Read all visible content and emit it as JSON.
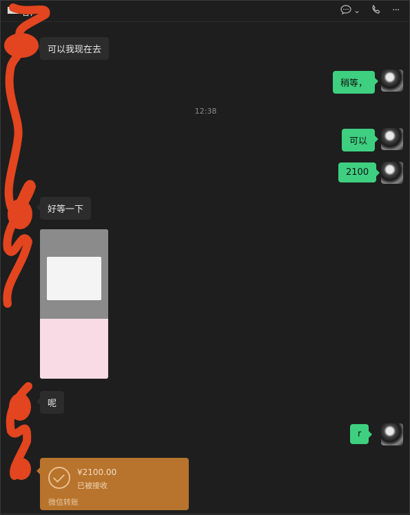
{
  "header": {
    "title": "客户",
    "icons": [
      "chat-icon",
      "chevron-down-icon",
      "phone-icon",
      "more-icon"
    ],
    "more_label": "···",
    "chevron_label": "⌄"
  },
  "messages": {
    "m1": "可以我现在去",
    "m2": "稍等，",
    "time": "12:38",
    "m3": "可以",
    "m4": "2100",
    "m5": "好等一下",
    "m7": "呢",
    "m8": "r"
  },
  "transfer": {
    "amount": "¥2100.00",
    "status": "已被接收",
    "footer": "微信转账"
  },
  "colors": {
    "background": "#1e1e1e",
    "outgoing_bubble": "#3ed080",
    "incoming_bubble": "#2c2c2c",
    "transfer_card": "#b8732c",
    "redaction": "#e2451f"
  }
}
